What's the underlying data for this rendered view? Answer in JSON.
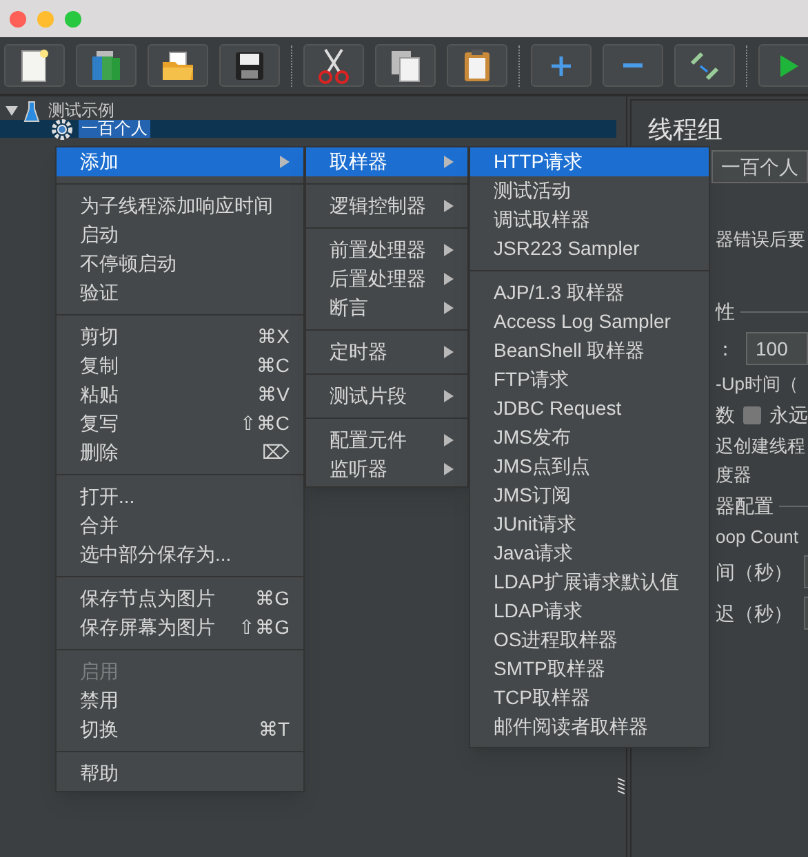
{
  "toolbar": {
    "buttons": [
      {
        "kind": "new"
      },
      {
        "kind": "templates"
      },
      {
        "kind": "open"
      },
      {
        "kind": "save"
      },
      {
        "kind": "separator"
      },
      {
        "kind": "cut"
      },
      {
        "kind": "copy"
      },
      {
        "kind": "paste"
      },
      {
        "kind": "separator"
      },
      {
        "kind": "add"
      },
      {
        "kind": "remove"
      },
      {
        "kind": "toggle"
      },
      {
        "kind": "separator"
      },
      {
        "kind": "start"
      }
    ]
  },
  "tree": [
    {
      "label": "测试示例",
      "kind": "plan",
      "expanded": true,
      "selected": false,
      "children": [
        {
          "label": "一百个人",
          "kind": "group",
          "selected": true
        }
      ]
    }
  ],
  "panel": {
    "title": "线程组",
    "name_value": "一百个人",
    "lines": [
      {
        "kind": "text",
        "text": "器错误后要"
      },
      {
        "kind": "gap"
      },
      {
        "kind": "rule",
        "text": "性"
      },
      {
        "kind": "field",
        "text": "：",
        "value": "100"
      },
      {
        "kind": "text",
        "text": "-Up时间（"
      },
      {
        "kind": "check",
        "text": "数",
        "label": "永远",
        "checked": false
      },
      {
        "kind": "text",
        "text": "迟创建线程"
      },
      {
        "kind": "text",
        "text": "度器"
      },
      {
        "kind": "rule",
        "text": "器配置"
      },
      {
        "kind": "text",
        "text": "oop Count"
      },
      {
        "kind": "field",
        "text": "间（秒）"
      },
      {
        "kind": "field",
        "text": "迟（秒）"
      }
    ]
  },
  "context_menu": [
    {
      "kind": "item",
      "label": "添加",
      "submenu": true,
      "selected": true
    },
    {
      "kind": "separator"
    },
    {
      "kind": "item",
      "label": "为子线程添加响应时间",
      "selected": false
    },
    {
      "kind": "item",
      "label": "启动",
      "selected": false
    },
    {
      "kind": "item",
      "label": "不停顿启动",
      "selected": false
    },
    {
      "kind": "item",
      "label": "验证",
      "selected": false
    },
    {
      "kind": "separator"
    },
    {
      "kind": "item",
      "label": "剪切",
      "shortcut": "⌘X",
      "selected": false
    },
    {
      "kind": "item",
      "label": "复制",
      "shortcut": "⌘C",
      "selected": false
    },
    {
      "kind": "item",
      "label": "粘贴",
      "shortcut": "⌘V",
      "selected": false
    },
    {
      "kind": "item",
      "label": "复写",
      "shortcut": "⇧⌘C",
      "selected": false
    },
    {
      "kind": "item",
      "label": "删除",
      "shortcut": "⌦",
      "selected": false
    },
    {
      "kind": "separator"
    },
    {
      "kind": "item",
      "label": "打开...",
      "selected": false
    },
    {
      "kind": "item",
      "label": "合并",
      "selected": false
    },
    {
      "kind": "item",
      "label": "选中部分保存为...",
      "selected": false
    },
    {
      "kind": "separator"
    },
    {
      "kind": "item",
      "label": "保存节点为图片",
      "shortcut": "⌘G",
      "selected": false
    },
    {
      "kind": "item",
      "label": "保存屏幕为图片",
      "shortcut": "⇧⌘G",
      "selected": false
    },
    {
      "kind": "separator"
    },
    {
      "kind": "item",
      "label": "启用",
      "disabled": true,
      "selected": false
    },
    {
      "kind": "item",
      "label": "禁用",
      "selected": false
    },
    {
      "kind": "item",
      "label": "切换",
      "shortcut": "⌘T",
      "selected": false
    },
    {
      "kind": "separator"
    },
    {
      "kind": "item",
      "label": "帮助",
      "selected": false
    }
  ],
  "add_menu": [
    {
      "kind": "item",
      "label": "取样器",
      "submenu": true,
      "selected": true
    },
    {
      "kind": "separator"
    },
    {
      "kind": "item",
      "label": "逻辑控制器",
      "submenu": true,
      "selected": false
    },
    {
      "kind": "separator"
    },
    {
      "kind": "item",
      "label": "前置处理器",
      "submenu": true,
      "selected": false
    },
    {
      "kind": "item",
      "label": "后置处理器",
      "submenu": true,
      "selected": false
    },
    {
      "kind": "item",
      "label": "断言",
      "submenu": true,
      "selected": false
    },
    {
      "kind": "separator"
    },
    {
      "kind": "item",
      "label": "定时器",
      "submenu": true,
      "selected": false
    },
    {
      "kind": "separator"
    },
    {
      "kind": "item",
      "label": "测试片段",
      "submenu": true,
      "selected": false
    },
    {
      "kind": "separator"
    },
    {
      "kind": "item",
      "label": "配置元件",
      "submenu": true,
      "selected": false
    },
    {
      "kind": "item",
      "label": "监听器",
      "submenu": true,
      "selected": false
    }
  ],
  "sampler_menu": [
    {
      "kind": "item",
      "label": "HTTP请求",
      "selected": true
    },
    {
      "kind": "item",
      "label": "测试活动",
      "selected": false
    },
    {
      "kind": "item",
      "label": "调试取样器",
      "selected": false
    },
    {
      "kind": "item",
      "label": "JSR223 Sampler",
      "selected": false
    },
    {
      "kind": "separator"
    },
    {
      "kind": "item",
      "label": "AJP/1.3 取样器",
      "selected": false
    },
    {
      "kind": "item",
      "label": "Access Log Sampler",
      "selected": false
    },
    {
      "kind": "item",
      "label": "BeanShell 取样器",
      "selected": false
    },
    {
      "kind": "item",
      "label": "FTP请求",
      "selected": false
    },
    {
      "kind": "item",
      "label": "JDBC Request",
      "selected": false
    },
    {
      "kind": "item",
      "label": "JMS发布",
      "selected": false
    },
    {
      "kind": "item",
      "label": "JMS点到点",
      "selected": false
    },
    {
      "kind": "item",
      "label": "JMS订阅",
      "selected": false
    },
    {
      "kind": "item",
      "label": "JUnit请求",
      "selected": false
    },
    {
      "kind": "item",
      "label": "Java请求",
      "selected": false
    },
    {
      "kind": "item",
      "label": "LDAP扩展请求默认值",
      "selected": false
    },
    {
      "kind": "item",
      "label": "LDAP请求",
      "selected": false
    },
    {
      "kind": "item",
      "label": "OS进程取样器",
      "selected": false
    },
    {
      "kind": "item",
      "label": "SMTP取样器",
      "selected": false
    },
    {
      "kind": "item",
      "label": "TCP取样器",
      "selected": false
    },
    {
      "kind": "item",
      "label": "邮件阅读者取样器",
      "selected": false
    }
  ]
}
